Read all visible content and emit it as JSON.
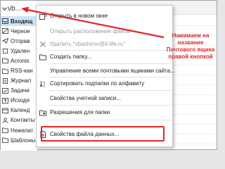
{
  "account": {
    "name": "vb..."
  },
  "folders": [
    {
      "label": "Входящ",
      "icon": "inbox-icon",
      "selected": true
    },
    {
      "label": "Черное",
      "icon": "blocked-icon"
    },
    {
      "label": "Отправ",
      "icon": "send-icon"
    },
    {
      "label": "Удален",
      "icon": "trash-icon"
    },
    {
      "label": "Acronis",
      "icon": "folder-icon"
    },
    {
      "label": "RSS-кан",
      "icon": "rss-icon"
    },
    {
      "label": "Журнал",
      "icon": "journal-icon"
    },
    {
      "label": "Задачи",
      "icon": "tasks-icon"
    },
    {
      "label": "Исходя",
      "icon": "outbox-icon"
    },
    {
      "label": "Календ",
      "icon": "calendar-icon"
    },
    {
      "label": "Контакты",
      "icon": "contacts-icon"
    },
    {
      "label": "Нежелат",
      "icon": "junk-icon"
    },
    {
      "label": "Шаблоны",
      "icon": "templates-icon"
    }
  ],
  "context_menu": {
    "items": [
      {
        "label": "Открыть в новом окне",
        "icon": "new-window-icon",
        "disabled": false
      },
      {
        "label": "Открыть расположение файла",
        "icon": "",
        "disabled": true
      },
      {
        "label": "Удалить \"vbashirov@it-life.ru\"",
        "icon": "delete-icon",
        "disabled": true
      },
      {
        "label": "Создать папку...",
        "icon": "new-folder-icon",
        "disabled": false
      },
      {
        "label": "Управление всеми почтовыми ящиками сайта...",
        "icon": "",
        "disabled": false
      },
      {
        "label": "Сортировать подпапки по алфавиту",
        "icon": "sort-az-icon",
        "disabled": false
      },
      {
        "label": "Свойства учетной записи...",
        "icon": "",
        "disabled": false
      },
      {
        "label": "Разрешения для папки",
        "icon": "folder-permissions-icon",
        "disabled": false
      },
      {
        "label": "Свойства файла данных...",
        "icon": "data-file-properties-icon",
        "disabled": false
      }
    ]
  },
  "annotation": {
    "text": "Нажимаем на название Почтового ящика правой кнопкой",
    "color": "#e0262b"
  },
  "colors": {
    "selection": "#cde3f7",
    "highlight": "#e0262b",
    "disabled_text": "#9a9a9a"
  }
}
